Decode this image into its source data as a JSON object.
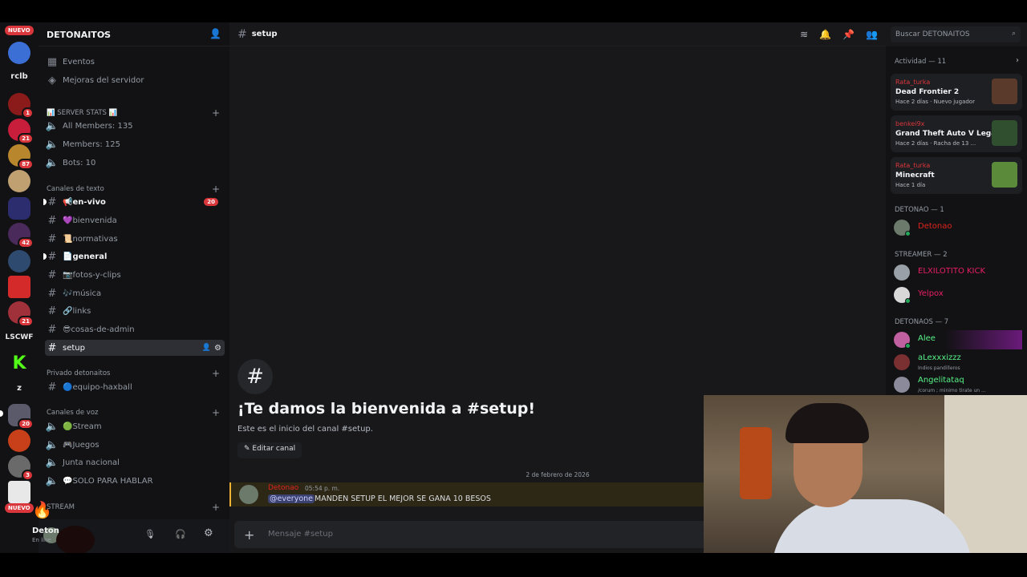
{
  "server": {
    "name": "DETONAITOS"
  },
  "rail": {
    "nuevo_top": "NUEVO",
    "nuevo_bottom": "NUEVO",
    "texts": [
      "rclb",
      "LSCWF",
      "z"
    ],
    "badges": [
      "1",
      "21",
      "87",
      "42",
      "21",
      "20",
      "3"
    ]
  },
  "sidebar": {
    "top_items": [
      "Eventos",
      "Mejoras del servidor"
    ],
    "categories": [
      "📊 SERVER STATS 📊",
      "Canales de texto",
      "Privado detonaitos",
      "Canales de voz",
      "STREAM"
    ],
    "stats": [
      "All Members: 135",
      "Members: 125",
      "Bots: 10"
    ],
    "text_channels": [
      "📢en-vivo",
      "💜bienvenida",
      "📜normativas",
      "📄general",
      "📷fotos-y-clips",
      "🎶música",
      "🔗links",
      "😎cosas-de-admin",
      "setup"
    ],
    "envivo_count": "20",
    "private_channels": [
      "🔵equipo-haxball"
    ],
    "voice_channels": [
      "🟢Stream",
      "🎮Juegos",
      "Junta nacional",
      "💬SOLO PARA HABLAR"
    ]
  },
  "user_panel": {
    "name": "Deton",
    "status": "En líne"
  },
  "main": {
    "channel": "setup",
    "welcome_title": "¡Te damos la bienvenida a #setup!",
    "welcome_sub": "Este es el inicio del canal #setup.",
    "edit_button": "Editar canal",
    "date_separator": "2 de febrero de 2026",
    "message": {
      "author": "Detonao",
      "time": "05:54 p. m.",
      "mention": "@everyone",
      "text": "MANDEN SETUP EL MEJOR SE GANA 10 BESOS"
    },
    "composer_placeholder": "Mensaje #setup",
    "search_placeholder": "Buscar DETONAITOS"
  },
  "members": {
    "activity_title": "Actividad — 11",
    "activities": [
      {
        "user": "Rata_turka",
        "game": "Dead Frontier 2",
        "meta": "Hace 2 días · Nuevo jugador",
        "color": "#5a3a2a"
      },
      {
        "user": "benkei9x",
        "game": "Grand Theft Auto V Legacy",
        "meta": "Hace 2 días · Racha de 13 ...",
        "color": "#2f4f2f"
      },
      {
        "user": "Rata_turka",
        "game": "Minecraft",
        "meta": "Hace 1 día",
        "color": "#5b8a3a"
      }
    ],
    "groups": [
      {
        "title": "DETONAO — 1",
        "members": [
          {
            "name": "Detonao",
            "color": "#e0231c",
            "status": ""
          }
        ]
      },
      {
        "title": "STREAMER — 2",
        "members": [
          {
            "name": "ELXILOTITO KICK",
            "color": "#e91e63",
            "status": ""
          },
          {
            "name": "Yelpox",
            "color": "#e91e63",
            "status": ""
          }
        ]
      },
      {
        "title": "DETONAOS — 7",
        "members": [
          {
            "name": "Alee",
            "color": "#57f287",
            "status": ""
          },
          {
            "name": "aLexxxizzz",
            "color": "#57f287",
            "status": "Indios pandilleros"
          },
          {
            "name": "Angelitataq",
            "color": "#57f287",
            "status": "/corum ; minimo tirate un ..."
          }
        ]
      }
    ]
  }
}
